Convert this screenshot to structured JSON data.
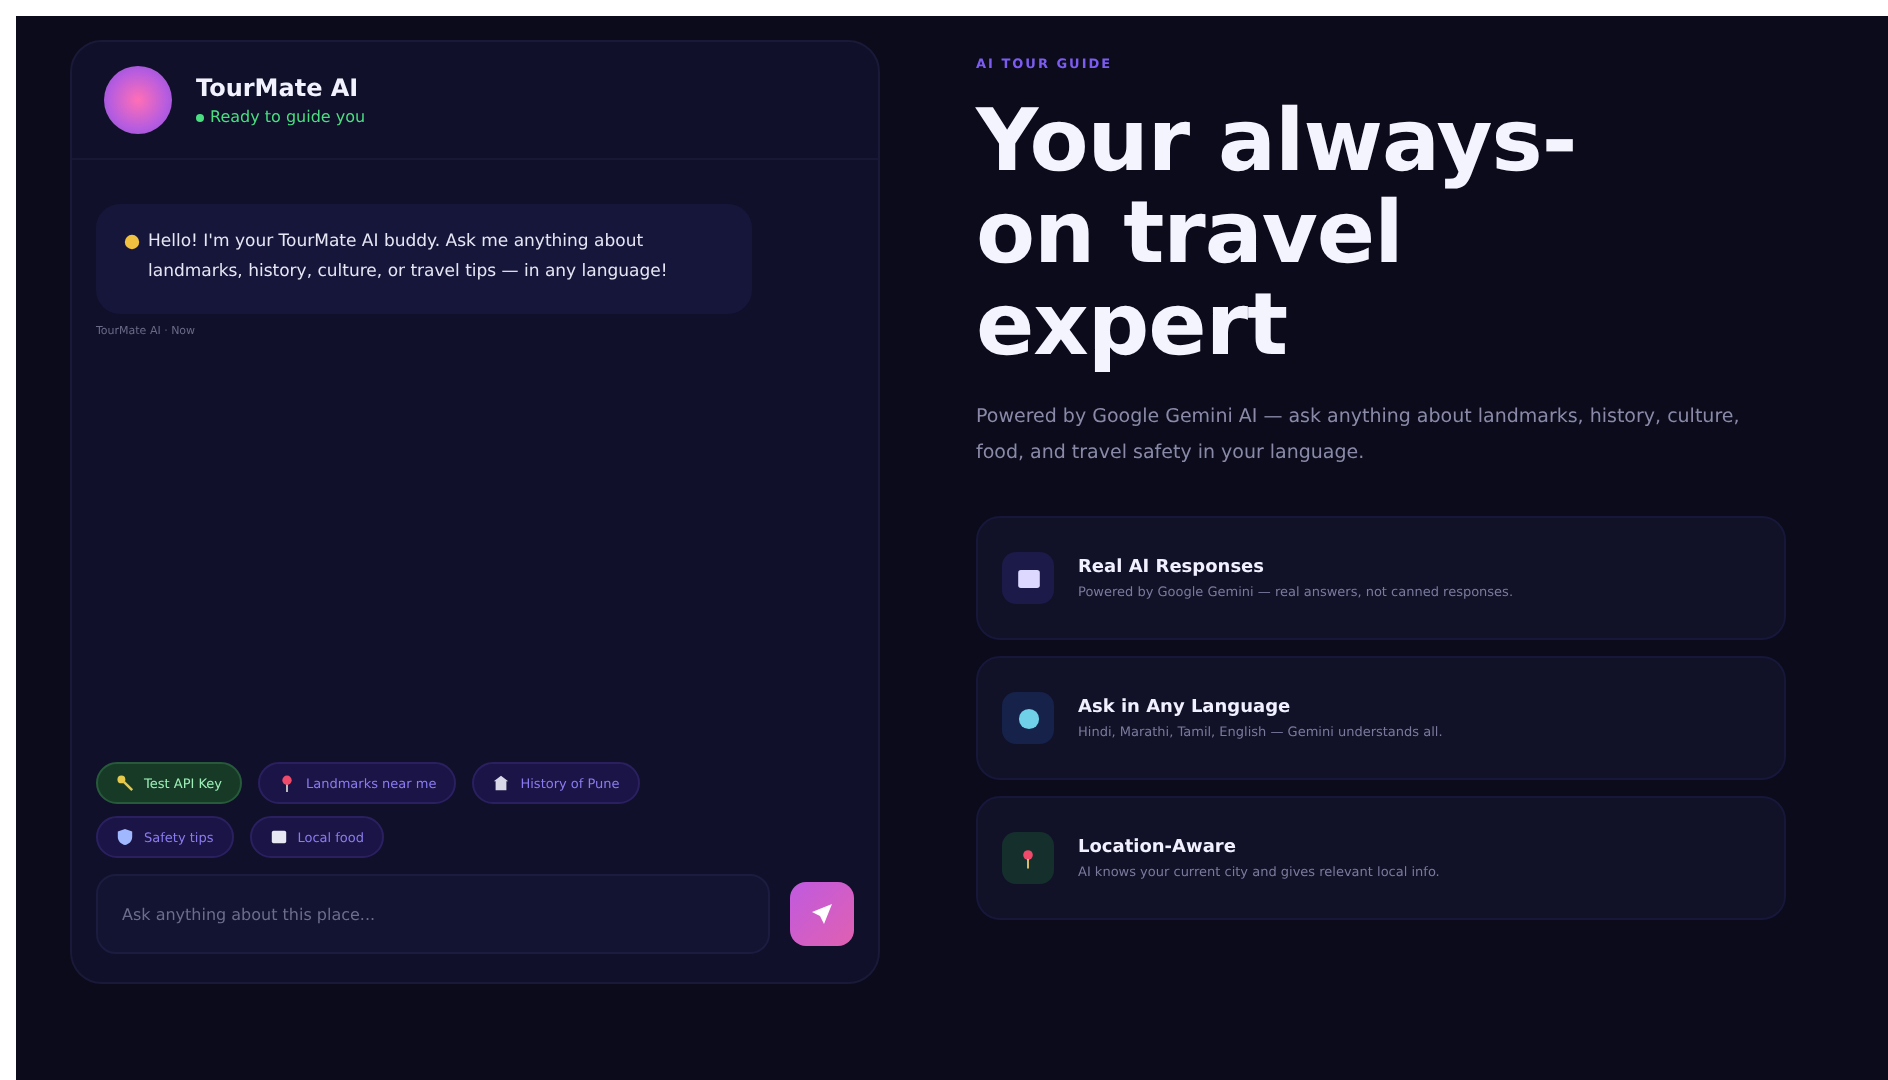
{
  "chat": {
    "bot_name": "TourMate AI",
    "status": "Ready to guide you",
    "online": true,
    "messages": [
      {
        "text": "Hello! I'm your TourMate AI buddy. Ask me anything about landmarks, history, culture, or travel tips — in any language!",
        "meta": "TourMate AI · Now"
      }
    ],
    "chips": [
      {
        "label": "Test API Key",
        "kind": "key"
      },
      {
        "label": "Landmarks near me",
        "kind": "suggestion"
      },
      {
        "label": "History of Pune",
        "kind": "suggestion"
      },
      {
        "label": "Safety tips",
        "kind": "suggestion"
      },
      {
        "label": "Local food",
        "kind": "suggestion"
      }
    ],
    "input": {
      "placeholder": "Ask anything about this place..."
    }
  },
  "hero": {
    "eyebrow": "AI TOUR GUIDE",
    "headline": [
      "Your always-",
      "on travel",
      "expert"
    ],
    "description": "Powered by Google Gemini AI — ask anything about landmarks, history, culture, food, and travel safety in your language.",
    "features": [
      {
        "title": "Real AI Responses",
        "text": "Powered by Google Gemini — real answers, not canned responses."
      },
      {
        "title": "Ask in Any Language",
        "text": "Hindi, Marathi, Tamil, English — Gemini understands all."
      },
      {
        "title": "Location-Aware",
        "text": "AI knows your current city and gives relevant local info."
      }
    ]
  }
}
